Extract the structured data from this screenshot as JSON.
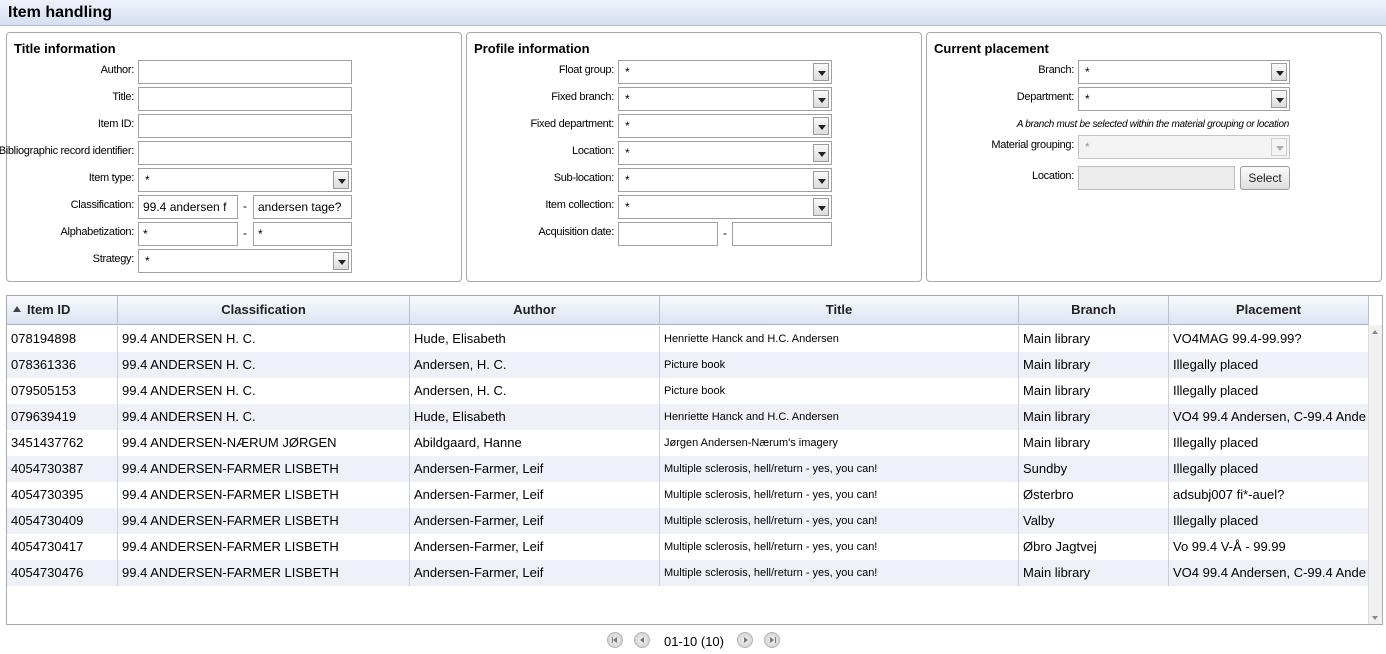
{
  "header": {
    "title": "Item handling"
  },
  "title_info": {
    "title": "Title information",
    "author_label": "Author:",
    "author_value": "",
    "title_label": "Title:",
    "title_value": "",
    "item_id_label": "Item ID:",
    "item_id_value": "",
    "bib_label": "Bibliographic record identifier:",
    "bib_value": "",
    "item_type_label": "Item type:",
    "item_type_value": "*",
    "classification_label": "Classification:",
    "classification_from": "99.4 andersen f",
    "classification_to": "andersen tage?",
    "alphabetization_label": "Alphabetization:",
    "alphabetization_from": "*",
    "alphabetization_to": "*",
    "strategy_label": "Strategy:",
    "strategy_value": "*",
    "range_sep": "-"
  },
  "profile_info": {
    "title": "Profile information",
    "float_group_label": "Float group:",
    "float_group_value": "*",
    "fixed_branch_label": "Fixed branch:",
    "fixed_branch_value": "*",
    "fixed_department_label": "Fixed department:",
    "fixed_department_value": "*",
    "location_label": "Location:",
    "location_value": "*",
    "sub_location_label": "Sub-location:",
    "sub_location_value": "*",
    "item_collection_label": "Item collection:",
    "item_collection_value": "*",
    "acquisition_label": "Acquisition date:",
    "acquisition_from": "",
    "acquisition_to": "",
    "range_sep": "-"
  },
  "current_placement": {
    "title": "Current placement",
    "branch_label": "Branch:",
    "branch_value": "*",
    "department_label": "Department:",
    "department_value": "*",
    "note": "A branch must be selected within the material grouping or location",
    "material_grouping_label": "Material grouping:",
    "material_grouping_value": "*",
    "location_label": "Location:",
    "location_value": "",
    "select_button": "Select"
  },
  "grid": {
    "columns": [
      "Item ID",
      "Classification",
      "Author",
      "Title",
      "Branch",
      "Placement"
    ],
    "sorted_column": "Item ID",
    "rows": [
      [
        "078194898",
        "99.4 ANDERSEN H. C.",
        "Hude, Elisabeth",
        "Henriette Hanck and H.C. Andersen",
        "Main library",
        "VO4MAG 99.4-99.99?"
      ],
      [
        "078361336",
        "99.4 ANDERSEN H. C.",
        "Andersen, H. C.",
        "Picture book",
        "Main library",
        "Illegally placed"
      ],
      [
        "079505153",
        "99.4 ANDERSEN H. C.",
        "Andersen, H. C.",
        "Picture book",
        "Main library",
        "Illegally placed"
      ],
      [
        "079639419",
        "99.4 ANDERSEN H. C.",
        "Hude, Elisabeth",
        "Henriette Hanck and H.C. Andersen",
        "Main library",
        "VO4 99.4 Andersen, C-99.4 Ande"
      ],
      [
        "3451437762",
        "99.4 ANDERSEN-NÆRUM JØRGEN",
        "Abildgaard, Hanne",
        "Jørgen Andersen-Nærum's imagery",
        "Main library",
        "Illegally placed"
      ],
      [
        "4054730387",
        "99.4 ANDERSEN-FARMER LISBETH",
        "Andersen-Farmer, Leif",
        "Multiple sclerosis, hell/return - yes, you can!",
        "Sundby",
        "Illegally placed"
      ],
      [
        "4054730395",
        "99.4 ANDERSEN-FARMER LISBETH",
        "Andersen-Farmer, Leif",
        "Multiple sclerosis, hell/return - yes, you can!",
        "Østerbro",
        "adsubj007 fi*-auel?"
      ],
      [
        "4054730409",
        "99.4 ANDERSEN-FARMER LISBETH",
        "Andersen-Farmer, Leif",
        "Multiple sclerosis, hell/return - yes, you can!",
        "Valby",
        "Illegally placed"
      ],
      [
        "4054730417",
        "99.4 ANDERSEN-FARMER LISBETH",
        "Andersen-Farmer, Leif",
        "Multiple sclerosis, hell/return - yes, you can!",
        "Øbro Jagtvej",
        "Vo 99.4 V-Å - 99.99"
      ],
      [
        "4054730476",
        "99.4 ANDERSEN-FARMER LISBETH",
        "Andersen-Farmer, Leif",
        "Multiple sclerosis, hell/return - yes, you can!",
        "Main library",
        "VO4 99.4 Andersen, C-99.4 Ande"
      ]
    ]
  },
  "pager": {
    "range_text": "01-10 (10)",
    "icons": [
      "first-page-icon",
      "previous-page-icon",
      "next-page-icon",
      "last-page-icon"
    ]
  }
}
